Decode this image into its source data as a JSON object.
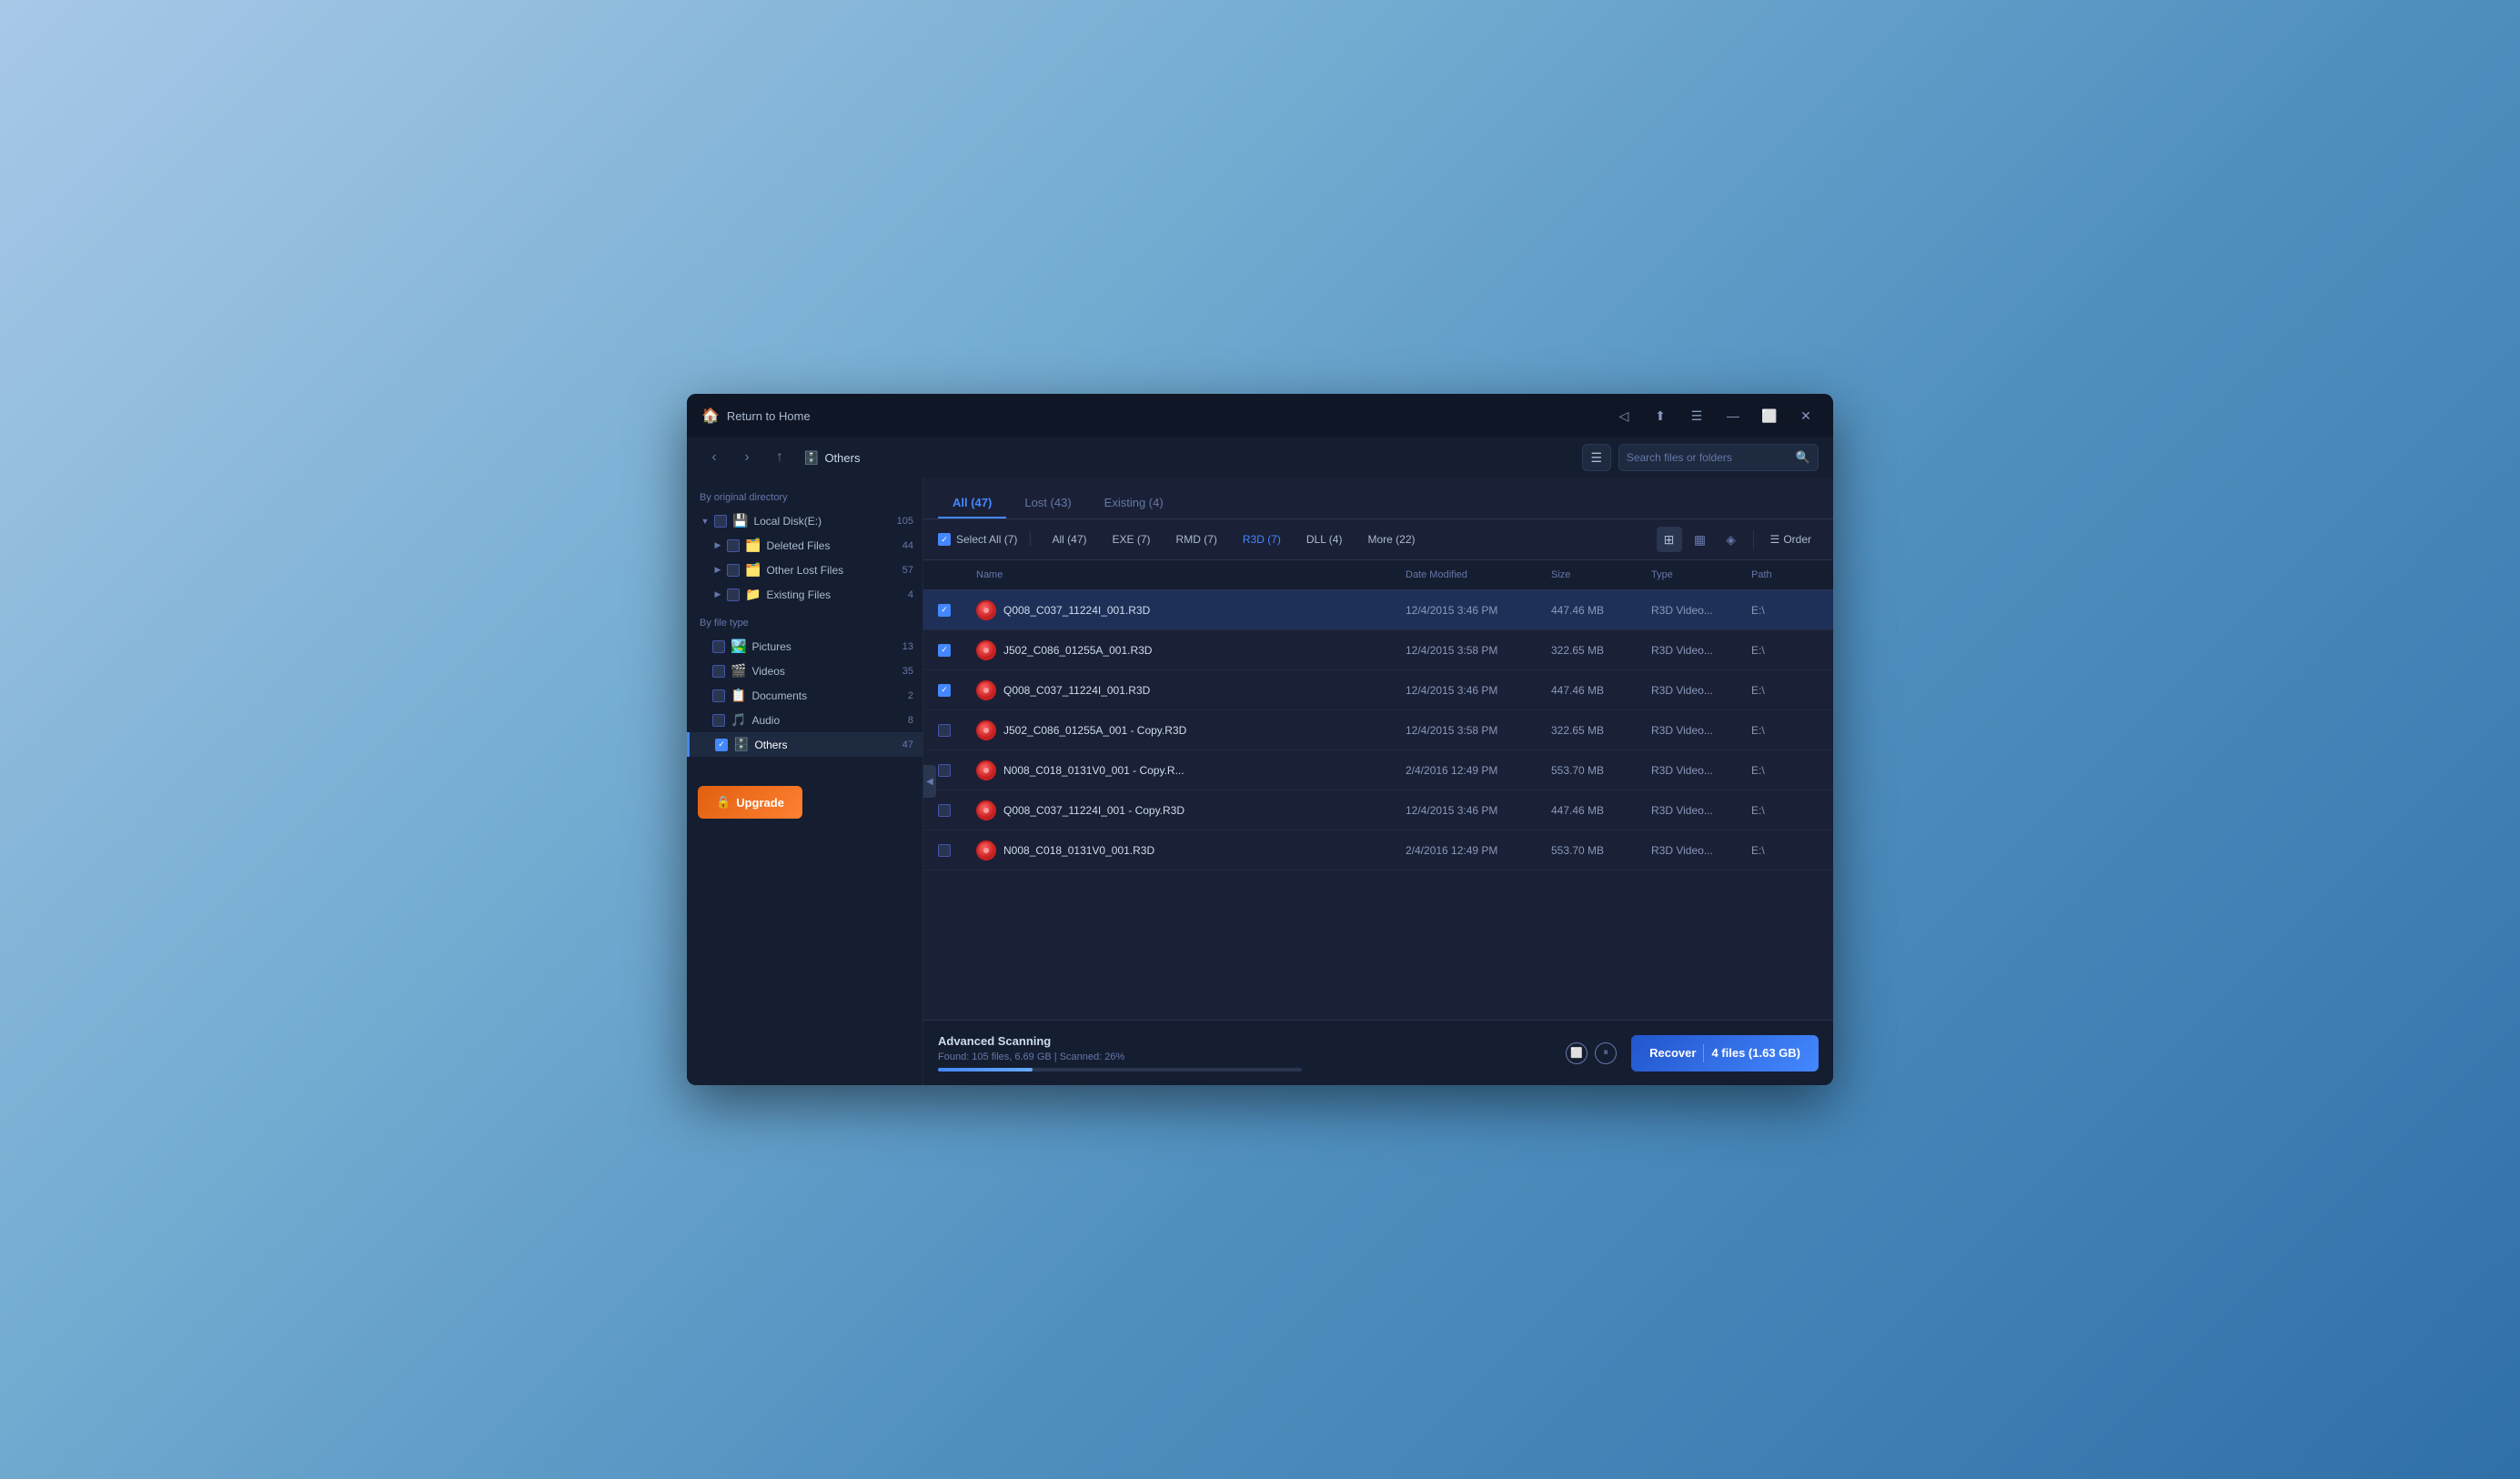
{
  "titleBar": {
    "title": "Return to Home",
    "controls": [
      "back",
      "share",
      "menu",
      "minimize",
      "maximize",
      "close"
    ]
  },
  "navBar": {
    "location": "Others",
    "locationIcon": "📁",
    "searchPlaceholder": "Search files or folders"
  },
  "sidebar": {
    "byOriginalDirectory": "By original directory",
    "byFileType": "By file type",
    "tree": [
      {
        "label": "Local Disk(E:)",
        "count": "105",
        "level": 0,
        "expanded": true,
        "checked": false,
        "icon": "💾"
      },
      {
        "label": "Deleted Files",
        "count": "44",
        "level": 1,
        "expanded": false,
        "checked": false,
        "icon": "🗂️"
      },
      {
        "label": "Other Lost Files",
        "count": "57",
        "level": 1,
        "expanded": false,
        "checked": false,
        "icon": "🗂️"
      },
      {
        "label": "Existing Files",
        "count": "4",
        "level": 1,
        "expanded": false,
        "checked": false,
        "icon": "📁"
      }
    ],
    "fileTypes": [
      {
        "label": "Pictures",
        "count": "13",
        "icon": "🏞️",
        "checked": false
      },
      {
        "label": "Videos",
        "count": "35",
        "icon": "🎬",
        "checked": false
      },
      {
        "label": "Documents",
        "count": "2",
        "icon": "📋",
        "checked": false
      },
      {
        "label": "Audio",
        "count": "8",
        "icon": "🎵",
        "checked": false
      },
      {
        "label": "Others",
        "count": "47",
        "icon": "🗄️",
        "checked": true,
        "active": true
      }
    ],
    "upgradeLabel": "Upgrade",
    "upgradeLockIcon": "🔒"
  },
  "content": {
    "tabs": [
      {
        "label": "All",
        "count": "47",
        "active": true
      },
      {
        "label": "Lost",
        "count": "43",
        "active": false
      },
      {
        "label": "Existing",
        "count": "4",
        "active": false
      }
    ],
    "filters": {
      "selectAll": "Select All",
      "selectCount": "7",
      "types": [
        {
          "label": "All",
          "count": "47"
        },
        {
          "label": "EXE",
          "count": "7"
        },
        {
          "label": "RMD",
          "count": "7"
        },
        {
          "label": "R3D",
          "count": "7",
          "active": true
        },
        {
          "label": "DLL",
          "count": "4"
        },
        {
          "label": "More",
          "count": "22"
        }
      ],
      "orderLabel": "Order"
    },
    "tableHeaders": [
      "",
      "Name",
      "Date Modified",
      "Size",
      "Type",
      "Path"
    ],
    "files": [
      {
        "checked": true,
        "name": "Q008_C037_11224I_001.R3D",
        "date": "12/4/2015 3:46 PM",
        "size": "447.46 MB",
        "type": "R3D Video...",
        "path": "E:\\",
        "selected": true
      },
      {
        "checked": true,
        "name": "J502_C086_01255A_001.R3D",
        "date": "12/4/2015 3:58 PM",
        "size": "322.65 MB",
        "type": "R3D Video...",
        "path": "E:\\",
        "selected": false
      },
      {
        "checked": true,
        "name": "Q008_C037_11224I_001.R3D",
        "date": "12/4/2015 3:46 PM",
        "size": "447.46 MB",
        "type": "R3D Video...",
        "path": "E:\\",
        "selected": false
      },
      {
        "checked": false,
        "name": "J502_C086_01255A_001 - Copy.R3D",
        "date": "12/4/2015 3:58 PM",
        "size": "322.65 MB",
        "type": "R3D Video...",
        "path": "E:\\",
        "selected": false
      },
      {
        "checked": false,
        "name": "N008_C018_0131V0_001 - Copy.R...",
        "date": "2/4/2016 12:49 PM",
        "size": "553.70 MB",
        "type": "R3D Video...",
        "path": "E:\\",
        "selected": false
      },
      {
        "checked": false,
        "name": "Q008_C037_11224I_001 - Copy.R3D",
        "date": "12/4/2015 3:46 PM",
        "size": "447.46 MB",
        "type": "R3D Video...",
        "path": "E:\\",
        "selected": false
      },
      {
        "checked": false,
        "name": "N008_C018_0131V0_001.R3D",
        "date": "2/4/2016 12:49 PM",
        "size": "553.70 MB",
        "type": "R3D Video...",
        "path": "E:\\",
        "selected": false
      }
    ]
  },
  "bottomBar": {
    "title": "Advanced Scanning",
    "stats": "Found: 105 files, 6.69 GB  |  Scanned: 26%",
    "progress": 26,
    "recoverLabel": "Recover",
    "recoverFiles": "4 files (1.63 GB)"
  }
}
